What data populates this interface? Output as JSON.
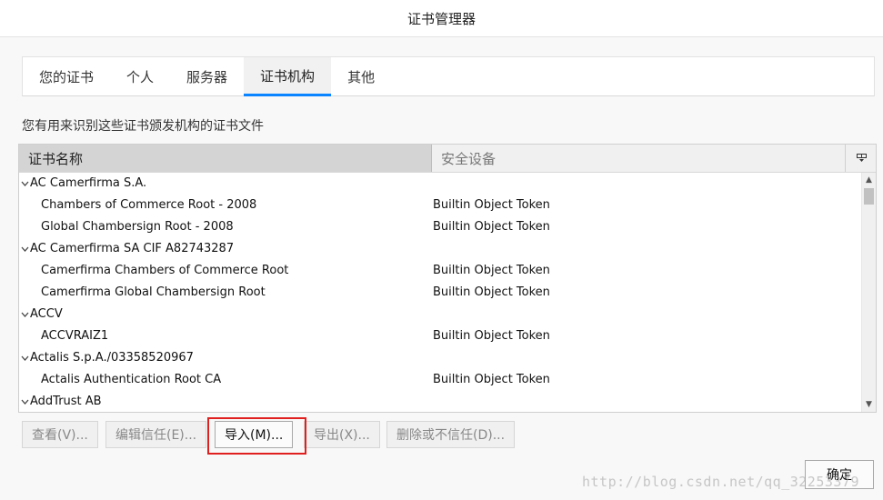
{
  "window": {
    "title": "证书管理器"
  },
  "tabs": [
    {
      "label": "您的证书",
      "active": false
    },
    {
      "label": "个人",
      "active": false
    },
    {
      "label": "服务器",
      "active": false
    },
    {
      "label": "证书机构",
      "active": true
    },
    {
      "label": "其他",
      "active": false
    }
  ],
  "description": "您有用来识别这些证书颁发机构的证书文件",
  "table": {
    "columns": [
      "证书名称",
      "安全设备"
    ],
    "column_picker_icon": "column-picker-icon",
    "rows": [
      {
        "type": "group",
        "name": "AC Camerfirma S.A.",
        "device": ""
      },
      {
        "type": "child",
        "name": "Chambers of Commerce Root - 2008",
        "device": "Builtin Object Token"
      },
      {
        "type": "child",
        "name": "Global Chambersign Root - 2008",
        "device": "Builtin Object Token"
      },
      {
        "type": "group",
        "name": "AC Camerfirma SA CIF A82743287",
        "device": ""
      },
      {
        "type": "child",
        "name": "Camerfirma Chambers of Commerce Root",
        "device": "Builtin Object Token"
      },
      {
        "type": "child",
        "name": "Camerfirma Global Chambersign Root",
        "device": "Builtin Object Token"
      },
      {
        "type": "group",
        "name": "ACCV",
        "device": ""
      },
      {
        "type": "child",
        "name": "ACCVRAIZ1",
        "device": "Builtin Object Token"
      },
      {
        "type": "group",
        "name": "Actalis S.p.A./03358520967",
        "device": ""
      },
      {
        "type": "child",
        "name": "Actalis Authentication Root CA",
        "device": "Builtin Object Token"
      },
      {
        "type": "group",
        "name": "AddTrust AB",
        "device": ""
      }
    ]
  },
  "buttons": {
    "view": "查看(V)...",
    "edit_trust": "编辑信任(E)...",
    "import": "导入(M)...",
    "export": "导出(X)...",
    "delete": "删除或不信任(D)...",
    "ok": "确定"
  },
  "watermark": "http://blog.csdn.net/qq_32253379",
  "colors": {
    "accent": "#0a84ff",
    "highlight": "#e0201e"
  }
}
